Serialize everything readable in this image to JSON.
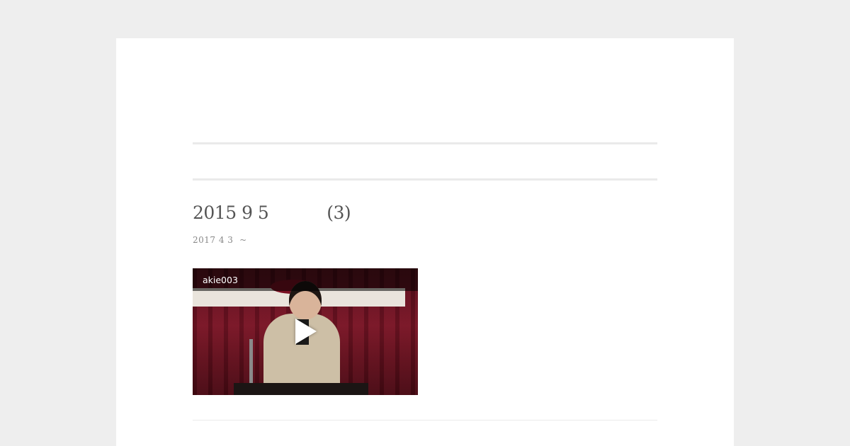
{
  "post": {
    "title": "2015 9 5           (3)",
    "meta": "2017 4 3  ~"
  },
  "video": {
    "title": "akie003",
    "play_icon": "play-icon"
  },
  "colors": {
    "page_background": "#eeeeee",
    "card_background": "#ffffff",
    "title_text": "#555555",
    "meta_text": "#888888",
    "rule": "#eaeaea"
  }
}
